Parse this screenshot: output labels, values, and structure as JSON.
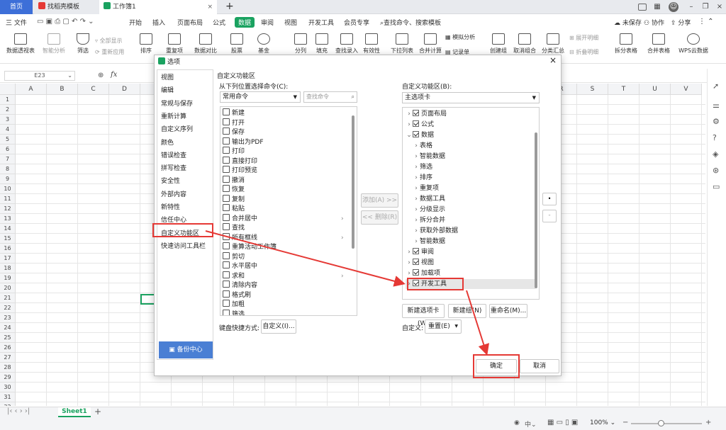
{
  "tabs": [
    {
      "label": "首页"
    },
    {
      "label": "找稻壳模板"
    },
    {
      "label": "工作簿1"
    }
  ],
  "tab_add": "+",
  "menu": {
    "file": "三 文件",
    "items": [
      "开始",
      "插入",
      "页面布局",
      "公式",
      "数据",
      "审阅",
      "视图",
      "开发工具",
      "会员专享"
    ],
    "active": "数据",
    "search_placeholder": "查找命令、搜索模板",
    "unsaved": "未保存",
    "collab": "协作",
    "share": "分享"
  },
  "ribbon": [
    "数据透视表",
    "智能分析",
    "筛选",
    "全部显示",
    "重新应用",
    "排序",
    "重复项",
    "数据对比",
    "股票",
    "基金",
    "分列",
    "填充",
    "查找录入",
    "有效性",
    "下拉列表",
    "合并计算",
    "模拟分析",
    "记录单",
    "创建组",
    "取消组合",
    "分类汇总",
    "展开明细",
    "折叠明细",
    "拆分表格",
    "合并表格",
    "WPS云数据"
  ],
  "formula": {
    "cell_ref": "E23",
    "fx": "fx"
  },
  "sheet": {
    "columns": [
      "A",
      "B",
      "C",
      "D",
      "E",
      "F",
      "G",
      "H",
      "I",
      "J",
      "K",
      "L",
      "M",
      "N",
      "O",
      "P",
      "Q",
      "R",
      "S",
      "T",
      "U",
      "V"
    ],
    "rows": [
      "1",
      "2",
      "3",
      "4",
      "5",
      "6",
      "7",
      "8",
      "9",
      "10",
      "11",
      "12",
      "13",
      "14",
      "15",
      "16",
      "17",
      "18",
      "19",
      "20",
      "21",
      "22",
      "23",
      "24",
      "25",
      "26",
      "27",
      "28",
      "29",
      "30",
      "31",
      "32"
    ],
    "sheet_tab": "Sheet1",
    "add_sheet": "+"
  },
  "status": {
    "zoom": "100%",
    "lang": "中"
  },
  "dialog": {
    "title": "选项",
    "close": "×",
    "nav": [
      "视图",
      "编辑",
      "常规与保存",
      "重新计算",
      "自定义序列",
      "颜色",
      "错误检查",
      "拼写检查",
      "安全性",
      "外部内容",
      "新特性",
      "信任中心",
      "自定义功能区",
      "快速访问工具栏"
    ],
    "nav_active": "自定义功能区",
    "backup": "备份中心",
    "section_title": "自定义功能区",
    "left_label": "从下列位置选择命令(C):",
    "left_select": "常用命令",
    "search_cmd_placeholder": "查找命令",
    "commands": [
      "新建",
      "打开",
      "保存",
      "输出为PDF",
      "打印",
      "直接打印",
      "打印预览",
      "撤消",
      "恢复",
      "复制",
      "粘贴",
      "合并居中",
      "查找",
      "所有框线",
      "重算活动工作簿",
      "剪切",
      "水平居中",
      "求和",
      "清除内容",
      "格式刷",
      "加粗",
      "筛选"
    ],
    "add_btn": "添加(A) >>",
    "remove_btn": "<< 删除(R)",
    "right_label": "自定义功能区(B):",
    "right_select": "主选项卡",
    "tree": [
      {
        "label": "页面布局",
        "level": 0,
        "expand": ">",
        "checked": true
      },
      {
        "label": "公式",
        "level": 0,
        "expand": ">",
        "checked": true
      },
      {
        "label": "数据",
        "level": 0,
        "expand": "v",
        "checked": true
      },
      {
        "label": "表格",
        "level": 1,
        "expand": ">",
        "checked": false
      },
      {
        "label": "智能数据",
        "level": 1,
        "expand": ">",
        "checked": false
      },
      {
        "label": "筛选",
        "level": 1,
        "expand": ">",
        "checked": false
      },
      {
        "label": "排序",
        "level": 1,
        "expand": ">",
        "checked": false
      },
      {
        "label": "重复项",
        "level": 1,
        "expand": ">",
        "checked": false
      },
      {
        "label": "数据工具",
        "level": 1,
        "expand": ">",
        "checked": false
      },
      {
        "label": "分级显示",
        "level": 1,
        "expand": ">",
        "checked": false
      },
      {
        "label": "拆分合并",
        "level": 1,
        "expand": ">",
        "checked": false
      },
      {
        "label": "获取外部数据",
        "level": 1,
        "expand": ">",
        "checked": false
      },
      {
        "label": "智能数据",
        "level": 1,
        "expand": ">",
        "checked": false
      },
      {
        "label": "审阅",
        "level": 0,
        "expand": ">",
        "checked": true
      },
      {
        "label": "视图",
        "level": 0,
        "expand": ">",
        "checked": true
      },
      {
        "label": "加载项",
        "level": 0,
        "expand": ">",
        "checked": true
      },
      {
        "label": "开发工具",
        "level": 0,
        "expand": ">",
        "checked": true
      }
    ],
    "up": "·",
    "down": "-",
    "new_tab": "新建选项卡(W)",
    "new_group": "新建组(N)",
    "rename": "重命名(M)...",
    "keyboard_label": "键盘快捷方式:",
    "keyboard_btn": "自定义(I)...",
    "custom_label": "自定义:",
    "reset_btn": "重置(E)",
    "ok": "确定",
    "cancel": "取消"
  },
  "colors": {
    "accent": "#1aa260",
    "highlight": "#e53935",
    "backup_blue": "#4a7fd4"
  }
}
